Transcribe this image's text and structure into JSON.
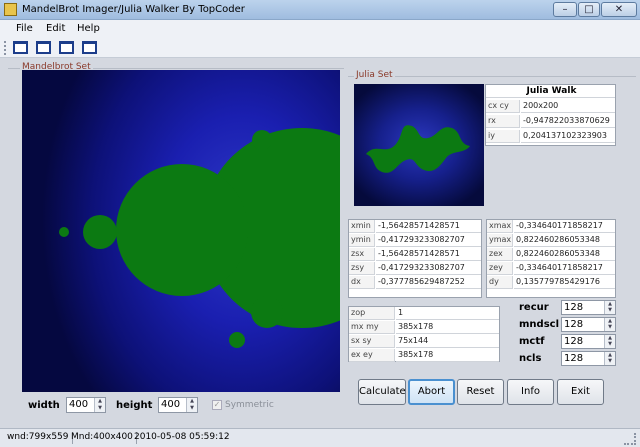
{
  "window": {
    "title": "MandelBrot Imager/Julia Walker By TopCoder",
    "min_glyph": "–",
    "max_glyph": "□",
    "close_glyph": "✕"
  },
  "menu": [
    "File",
    "Edit",
    "Help"
  ],
  "mandelbrot": {
    "group_label": "Mandelbrot Set",
    "set_color": "#0c7a12",
    "width_label": "width",
    "width_value": "400",
    "height_label": "height",
    "height_value": "400",
    "symmetric_label": "Symmetric",
    "symmetric_mark": "✓"
  },
  "julia": {
    "group_label": "Julia Set",
    "walk_title": "Julia Walk",
    "walk_rows": [
      {
        "label": "cx cy",
        "value": "200x200"
      },
      {
        "label": "rx",
        "value": "-0,947822033870629"
      },
      {
        "label": "iy",
        "value": "0,204137102323903"
      }
    ]
  },
  "params_left": [
    {
      "label": "xmin",
      "value": "-1,56428571428571"
    },
    {
      "label": "ymin",
      "value": "-0,417293233082707"
    },
    {
      "label": "zsx",
      "value": "-1,56428571428571"
    },
    {
      "label": "zsy",
      "value": "-0,417293233082707"
    },
    {
      "label": "dx",
      "value": "-0,377785629487252"
    }
  ],
  "params_right": [
    {
      "label": "xmax",
      "value": "-0,334640171858217"
    },
    {
      "label": "ymax",
      "value": "0,822460286053348"
    },
    {
      "label": "zex",
      "value": "0,822460286053348"
    },
    {
      "label": "zey",
      "value": "-0,334640171858217"
    },
    {
      "label": "dy",
      "value": "0,135779785429176"
    }
  ],
  "mouse_grid": [
    {
      "label": "zop",
      "value": "1"
    },
    {
      "label": "mx my",
      "value": "385x178"
    },
    {
      "label": "sx sy",
      "value": "75x144"
    },
    {
      "label": "ex ey",
      "value": "385x178"
    }
  ],
  "spinners": [
    {
      "label": "recur",
      "value": "128"
    },
    {
      "label": "mndscl",
      "value": "128"
    },
    {
      "label": "mctf",
      "value": "128"
    },
    {
      "label": "ncls",
      "value": "128"
    }
  ],
  "buttons": {
    "calculate": "Calculate",
    "abort": "Abort",
    "reset": "Reset",
    "info": "Info",
    "exit": "Exit"
  },
  "status": {
    "window_size": "wnd:799x559",
    "mandel_size": "Mnd:400x400",
    "timestamp": "2010-05-08 05:59:12"
  },
  "arrows": {
    "up": "▲",
    "down": "▼"
  }
}
